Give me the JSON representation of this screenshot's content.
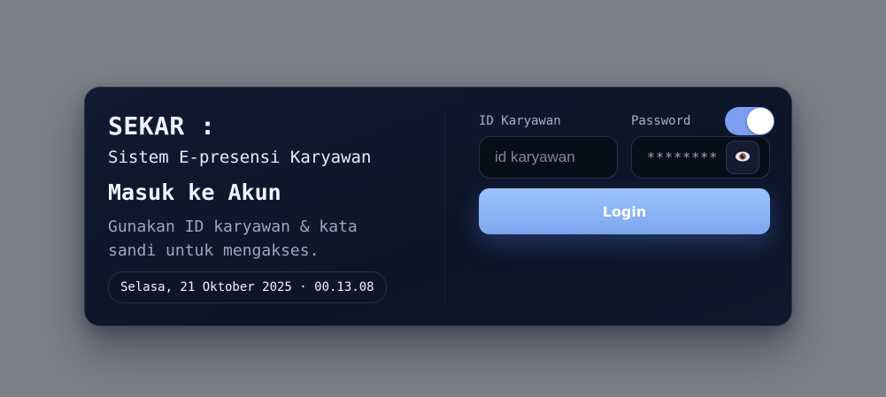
{
  "brand": {
    "title": "SEKAR :",
    "subtitle": "Sistem E-presensi Karyawan"
  },
  "intro": {
    "heading": "Masuk ke Akun",
    "description": "Gunakan ID karyawan & kata sandi untuk mengakses."
  },
  "clock": {
    "datetime": "Selasa, 21 Oktober 2025 · 00.13.08"
  },
  "form": {
    "id_label": "ID Karyawan",
    "id_placeholder": "id karyawan",
    "id_value": "",
    "password_label": "Password",
    "password_placeholder": "********",
    "password_value": "",
    "show_password_icon": "eye-icon",
    "theme_toggle_on": true,
    "login_label": "Login"
  },
  "colors": {
    "accent": "#7b9ef0",
    "button_top": "#9cc3ff",
    "card_bg": "#0d1528"
  }
}
